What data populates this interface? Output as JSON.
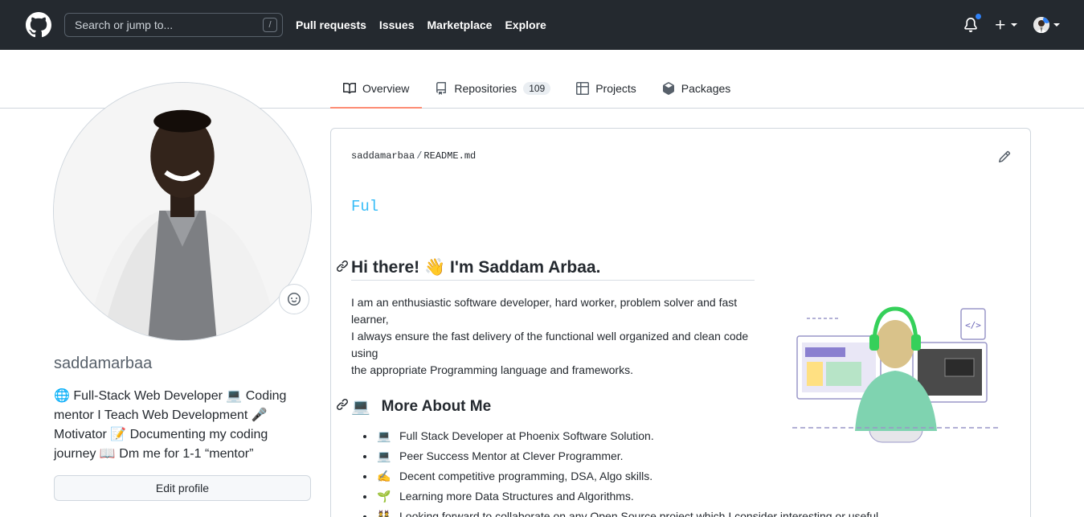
{
  "header": {
    "search_placeholder": "Search or jump to...",
    "search_shortcut": "/",
    "nav": [
      "Pull requests",
      "Issues",
      "Marketplace",
      "Explore"
    ]
  },
  "tabs": [
    {
      "label": "Overview",
      "icon": "book-icon",
      "active": true
    },
    {
      "label": "Repositories",
      "icon": "repo-icon",
      "count": "109"
    },
    {
      "label": "Projects",
      "icon": "table-icon"
    },
    {
      "label": "Packages",
      "icon": "package-icon"
    }
  ],
  "profile": {
    "username": "saddamarbaa",
    "bio": "🌐 Full-Stack Web Developer 💻 Coding mentor I Teach Web Development 🎤 Motivator 📝 Documenting my coding journey 📖 Dm me for 1-1 “mentor”",
    "edit_label": "Edit profile"
  },
  "readme": {
    "owner": "saddamarbaa",
    "separator": "/",
    "file": "README.md",
    "typing_text": "Ful",
    "heading": "Hi there! 👋 I'm Saddam Arbaa.",
    "para_lines": [
      "I am an enthusiastic software developer, hard worker, problem solver and fast",
      "learner,",
      "I always ensure the fast delivery of the functional well organized and clean code",
      "using",
      "the appropriate Programming language and frameworks."
    ],
    "more_heading_emoji": "💻",
    "more_heading": "More About Me",
    "list": [
      {
        "emoji": "💻",
        "text": "Full Stack Developer at Phoenix Software Solution."
      },
      {
        "emoji": "💻",
        "text": "Peer Success Mentor at Clever Programmer."
      },
      {
        "emoji": "✍️",
        "text": "Decent competitive programming, DSA, Algo skills."
      },
      {
        "emoji": "🌱",
        "text": "Learning more Data Structures and Algorithms."
      },
      {
        "emoji": "👯",
        "text": "Looking forward to collaborate on any Open Source project which I consider interesting or useful."
      }
    ]
  },
  "colors": {
    "header_bg": "#24292f",
    "active_tab_underline": "#fd8c73",
    "notification_dot": "#2f81f7",
    "typing_text": "#36bcf7"
  }
}
